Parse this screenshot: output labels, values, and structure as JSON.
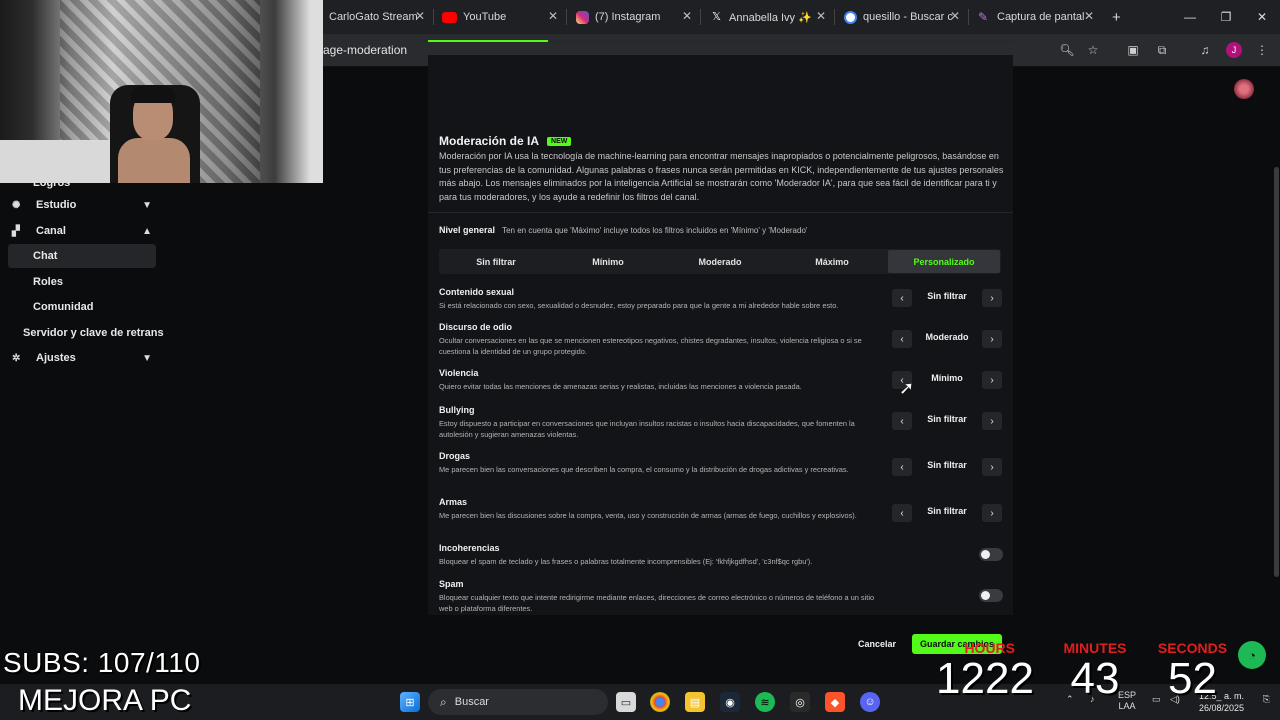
{
  "browser": {
    "tabs": [
      {
        "title": "CarloGato Stream",
        "color": "#3a3a3a"
      },
      {
        "title": "YouTube",
        "color": "#ff0000"
      },
      {
        "title": "(7) Instagram",
        "color": "#d62976"
      },
      {
        "title": "Annabella Ivy ✨",
        "color": "#111111"
      },
      {
        "title": "quesillo - Buscar c",
        "color": "#4285f4"
      },
      {
        "title": "Captura de pantal",
        "color": "#9b59b6"
      }
    ],
    "new_tab": "+",
    "url": "age-moderation",
    "profile_initial": "J"
  },
  "sidebar": {
    "partial_top": "Logros",
    "items": [
      {
        "label": "Estudio",
        "icon": "palette-icon",
        "chevron": "⌄"
      },
      {
        "label": "Canal",
        "icon": "channel-icon",
        "chevron": "⌃"
      },
      {
        "label": "Chat"
      },
      {
        "label": "Roles"
      },
      {
        "label": "Comunidad"
      },
      {
        "label": "Servidor y clave de retrans"
      },
      {
        "label": "Ajustes",
        "icon": "gear-icon",
        "chevron": "⌄"
      }
    ]
  },
  "moderation": {
    "title": "Moderación de IA",
    "badge": "NEW",
    "description": "Moderación por IA usa la tecnología de machine-learning para encontrar mensajes inapropiados o potencialmente peligrosos, basándose en tus preferencias de la comunidad. Algunas palabras o frases nunca serán permitidas en KICK, independientemente de tus ajustes personales más abajo. Los mensajes eliminados por la inteligencia Artificial se mostrarán como 'Moderador IA', para que sea fácil de identificar para ti y para tus moderadores, y los ayude a redefinir los filtros del canal.",
    "level_label": "Nivel general",
    "level_hint": "Ten en cuenta que 'Máximo' incluye todos los filtros incluidos en 'Mínimo' y 'Moderado'",
    "levels": [
      "Sin filtrar",
      "Mínimo",
      "Moderado",
      "Máximo",
      "Personalizado"
    ],
    "selected_level": "Personalizado",
    "rules": [
      {
        "title": "Contenido sexual",
        "desc": "Si está relacionado con sexo, sexualidad o desnudez, estoy preparado para que la gente a mi alrededor hable sobre esto.",
        "value": "Sin filtrar"
      },
      {
        "title": "Discurso de odio",
        "desc": "Ocultar conversaciones en las que se mencionen estereotipos negativos, chistes degradantes, insultos, violencia religiosa o si se cuestiona la identidad de un grupo protegido.",
        "value": "Moderado"
      },
      {
        "title": "Violencia",
        "desc": "Quiero evitar todas las menciones de amenazas serias y realistas, incluidas las menciones a violencia pasada.",
        "value": "Mínimo"
      },
      {
        "title": "Bullying",
        "desc": "Estoy dispuesto a participar en conversaciones que incluyan insultos racistas o insultos hacia discapacidades, que fomenten la autolesión y sugieran amenazas violentas.",
        "value": "Sin filtrar"
      },
      {
        "title": "Drogas",
        "desc": "Me parecen bien las conversaciones que describen la compra, el consumo y la distribución de drogas adictivas y recreativas.",
        "value": "Sin filtrar"
      },
      {
        "title": "Armas",
        "desc": "Me parecen bien las discusiones sobre la compra, venta, uso y construcción de armas (armas de fuego, cuchillos y explosivos).",
        "value": "Sin filtrar"
      }
    ],
    "toggles": [
      {
        "title": "Incoherencias",
        "desc": "Bloquear el spam de teclado y las frases o palabras totalmente incomprensibles (Ej: 'fkhfjkgdfhsd', 'c3nf$qc rgbu').",
        "on": false
      },
      {
        "title": "Spam",
        "desc": "Bloquear cualquier texto que intente redirigirme mediante enlaces, direcciones de correo electrónico o números de teléfono a un sitio web o plataforma diferentes.",
        "on": false
      }
    ],
    "cancel_label": "Cancelar",
    "save_label": "Guardar cambios"
  },
  "overlay": {
    "subs": "SUBS: 107/110",
    "brand": "MEJORA PC",
    "timer": [
      {
        "label": "HOURS",
        "value": "1222"
      },
      {
        "label": "MINUTES",
        "value": "43"
      },
      {
        "label": "SECONDS",
        "value": "52"
      }
    ]
  },
  "taskbar": {
    "search_label": "Buscar",
    "lang": "ESP",
    "lang_sub": "LAA",
    "time": "12:5_ a. m.",
    "date": "26/08/2025"
  },
  "colors": {
    "accent": "#53fc18",
    "background": "#0b0c0e",
    "panel": "#131417",
    "timer_label": "#e21e1e"
  }
}
